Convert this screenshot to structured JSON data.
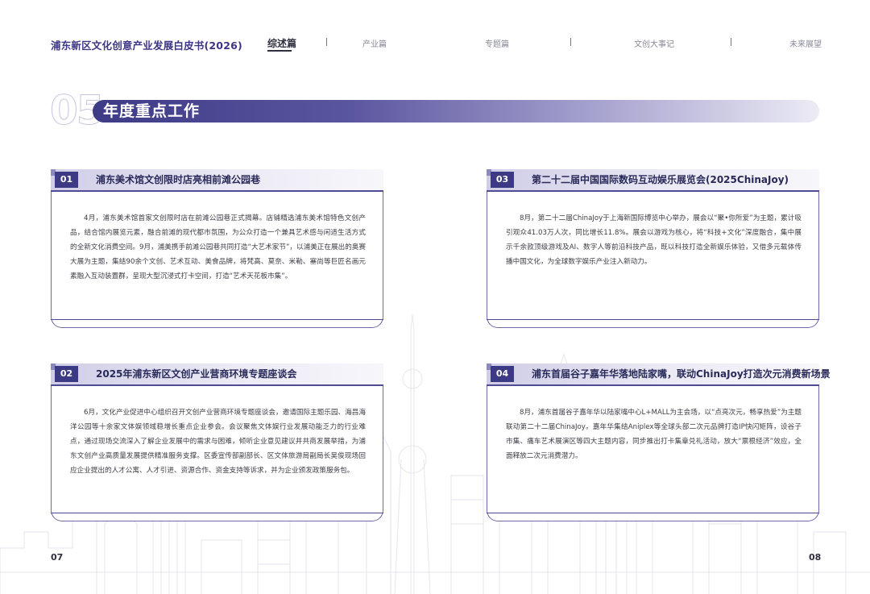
{
  "header": {
    "doc_title": "浦东新区文化创意产业发展白皮书(2026)",
    "nav": [
      "综述篇",
      "产业篇",
      "专题篇",
      "文创大事记",
      "未来展望"
    ],
    "active_nav": "综述篇"
  },
  "section": {
    "number": "05",
    "title": "年度重点工作"
  },
  "cards": [
    {
      "num": "01",
      "title": "浦东美术馆文创限时店亮相前滩公园巷",
      "body": "4月，浦东美术馆首家文创限时店在前滩公园巷正式揭幕。店铺精选浦东美术馆特色文创产品，结合馆内展览元素，融合前滩的现代都市氛围，为公众打造一个兼具艺术感与闲适生活方式的全新文化消费空间。9月，浦美携手前滩公园巷共同打造“大艺术家节”，以浦美正在展出的奥赛大展为主题，集结90余个文创、艺术互动、美食品牌，将梵高、莫奈、米勒、塞尚等巨匠名画元素融入互动装置群，呈现大型沉浸式打卡空间，打造“艺术天花板市集”。"
    },
    {
      "num": "02",
      "title": "2025年浦东新区文创产业营商环境专题座谈会",
      "body": "6月，文化产业促进中心组织召开文创产业营商环境专题座谈会，邀请国际主题乐园、海昌海洋公园等十余家文体娱领域稳增长重点企业参会。会议聚焦文体娱行业发展动能乏力的行业难点，通过现场交流深入了解企业发展中的需求与困难，倾听企业意见建议并共商发展举措，为浦东文创产业高质量发展提供精准服务支撑。区委宣传部副部长、区文体旅游局副局长吴俊现场回应企业提出的人才公寓、人才引进、资源合作、资金支持等诉求，并为企业颁发政策服务包。"
    },
    {
      "num": "03",
      "title": "第二十二届中国国际数码互动娱乐展览会(2025ChinaJoy)",
      "body": "8月，第二十二届ChinaJoy于上海新国际博览中心举办，展会以“聚•你所爱”为主题，累计吸引观众41.03万人次，同比增长11.8%。展会以游戏为核心，将“科技+文化”深度融合，集中展示千余款顶级游戏及AI、数字人等前沿科技产品，既以科技打造全新娱乐体验，又借多元载体传播中国文化，为全球数字娱乐产业注入新动力。"
    },
    {
      "num": "04",
      "title": "浦东首届谷子嘉年华落地陆家嘴，联动ChinaJoy打造次元消费新场景",
      "body": "8月，浦东首届谷子嘉年华以陆家嘴中心L+MALL为主会场，以“点亮次元，畅享热爱”为主题联动第二十二届ChinaJoy。嘉年华集结Aniplex等全球头部二次元品牌打造IP快闪矩阵，设谷子市集、痛车艺术展演区等四大主题内容，同步推出打卡集章兑礼活动，放大“票根经济”效应，全面释放二次元消费潜力。"
    }
  ],
  "pages": {
    "left": "07",
    "right": "08"
  }
}
